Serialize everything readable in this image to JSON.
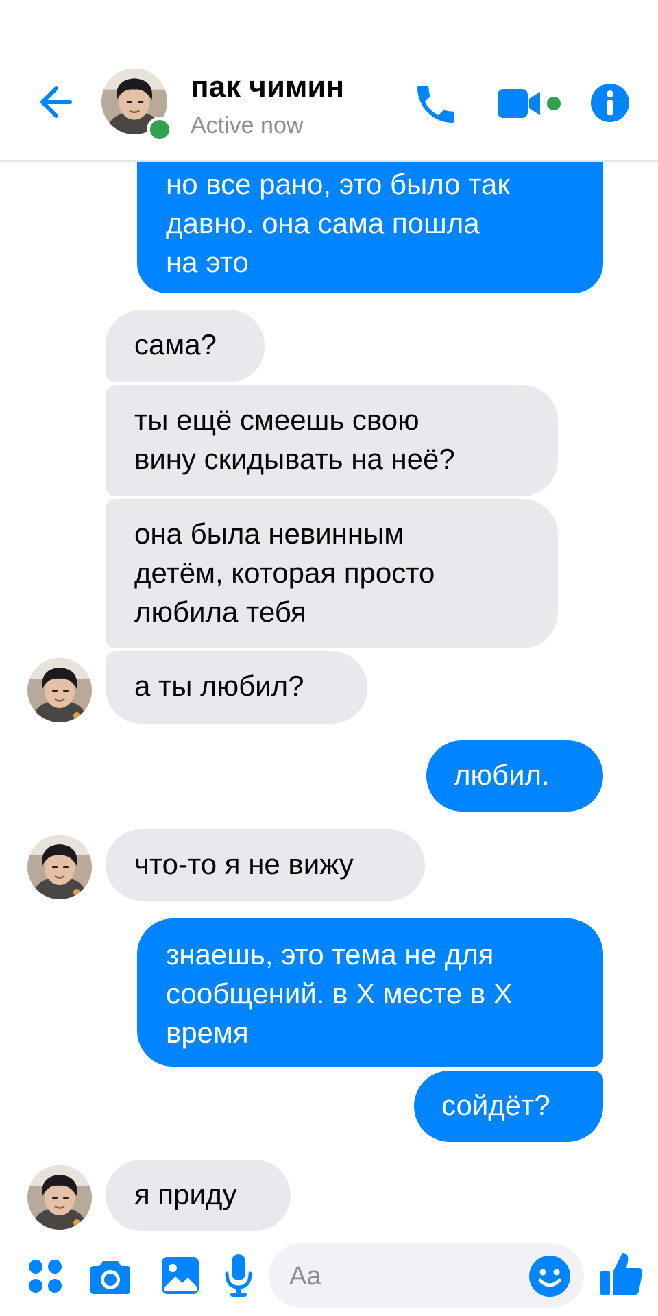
{
  "header": {
    "name": "пак чимин",
    "status": "Active now",
    "accent": "#0084ff",
    "online_color": "#31a24c"
  },
  "messages": [
    {
      "dir": "out",
      "lines": [
        "но все рано, это было так",
        "давно. она сама пошла",
        "на это"
      ]
    },
    {
      "dir": "in",
      "lines": [
        "сама?"
      ]
    },
    {
      "dir": "in",
      "lines": [
        "ты ещё смеешь свою",
        "вину скидывать на неё?"
      ]
    },
    {
      "dir": "in",
      "lines": [
        "она была невинным",
        "детём, которая просто",
        "любила тебя"
      ]
    },
    {
      "dir": "in",
      "lines": [
        "а ты любил?"
      ]
    },
    {
      "dir": "out",
      "lines": [
        "любил."
      ]
    },
    {
      "dir": "in",
      "lines": [
        "что-то я не вижу"
      ]
    },
    {
      "dir": "out",
      "lines": [
        "знаешь, это тема не для",
        "сообщений. в Х месте в Х",
        "время"
      ]
    },
    {
      "dir": "out",
      "lines": [
        "сойдёт?"
      ]
    },
    {
      "dir": "in",
      "lines": [
        "я приду"
      ]
    }
  ],
  "composer": {
    "placeholder": "Aa",
    "icons": [
      "apps-icon",
      "camera-icon",
      "gallery-icon",
      "microphone-icon",
      "emoji-icon",
      "like-icon"
    ]
  },
  "colors": {
    "outgoing_bubble": "#0084ff",
    "incoming_bubble": "#e9e8ec"
  }
}
